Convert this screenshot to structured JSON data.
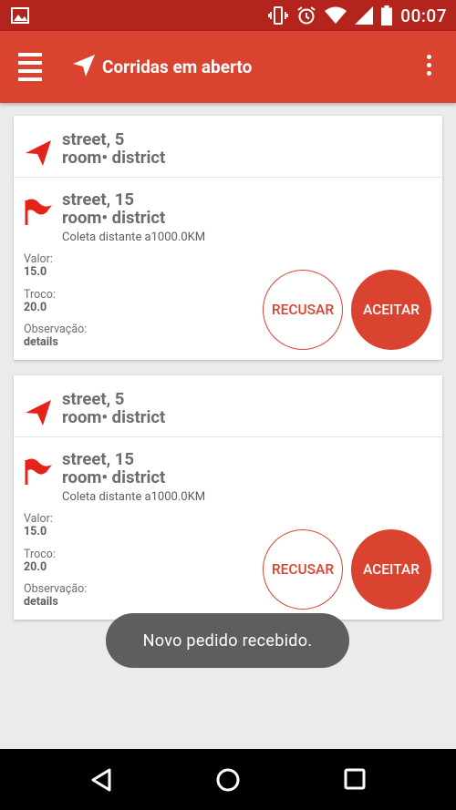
{
  "status_bar": {
    "time": "00:07"
  },
  "app_bar": {
    "title": "Corridas em aberto"
  },
  "orders": [
    {
      "pickup_line1": "street, 5",
      "pickup_line2": "room• district",
      "dest_line1": "street, 15",
      "dest_line2": "room• district",
      "distance": "Coleta distante a1000.0KM",
      "valor_label": "Valor:",
      "valor": "15.0",
      "troco_label": "Troco:",
      "troco": "20.0",
      "obs_label": "Observação:",
      "obs": "details",
      "refuse_label": "RECUSAR",
      "accept_label": "ACEITAR"
    },
    {
      "pickup_line1": "street, 5",
      "pickup_line2": "room• district",
      "dest_line1": "street, 15",
      "dest_line2": "room• district",
      "distance": "Coleta distante a1000.0KM",
      "valor_label": "Valor:",
      "valor": "15.0",
      "troco_label": "Troco:",
      "troco": "20.0",
      "obs_label": "Observação:",
      "obs": "details",
      "refuse_label": "RECUSAR",
      "accept_label": "ACEITAR"
    }
  ],
  "toast": {
    "message": "Novo pedido recebido."
  },
  "icons": {
    "status_left": "image-icon",
    "status_right": [
      "vibrate-icon",
      "alarm-icon",
      "wifi-icon",
      "signal-icon",
      "battery-icon"
    ],
    "app_bar": [
      "menu-icon",
      "navigation-icon",
      "overflow-icon"
    ],
    "card": [
      "navigation-arrow-icon",
      "flag-icon"
    ],
    "nav_bar": [
      "back-icon",
      "home-icon",
      "recents-icon"
    ]
  },
  "colors": {
    "primary": "#d9432f",
    "status_bar": "#b3241c",
    "background": "#ebebeb"
  }
}
